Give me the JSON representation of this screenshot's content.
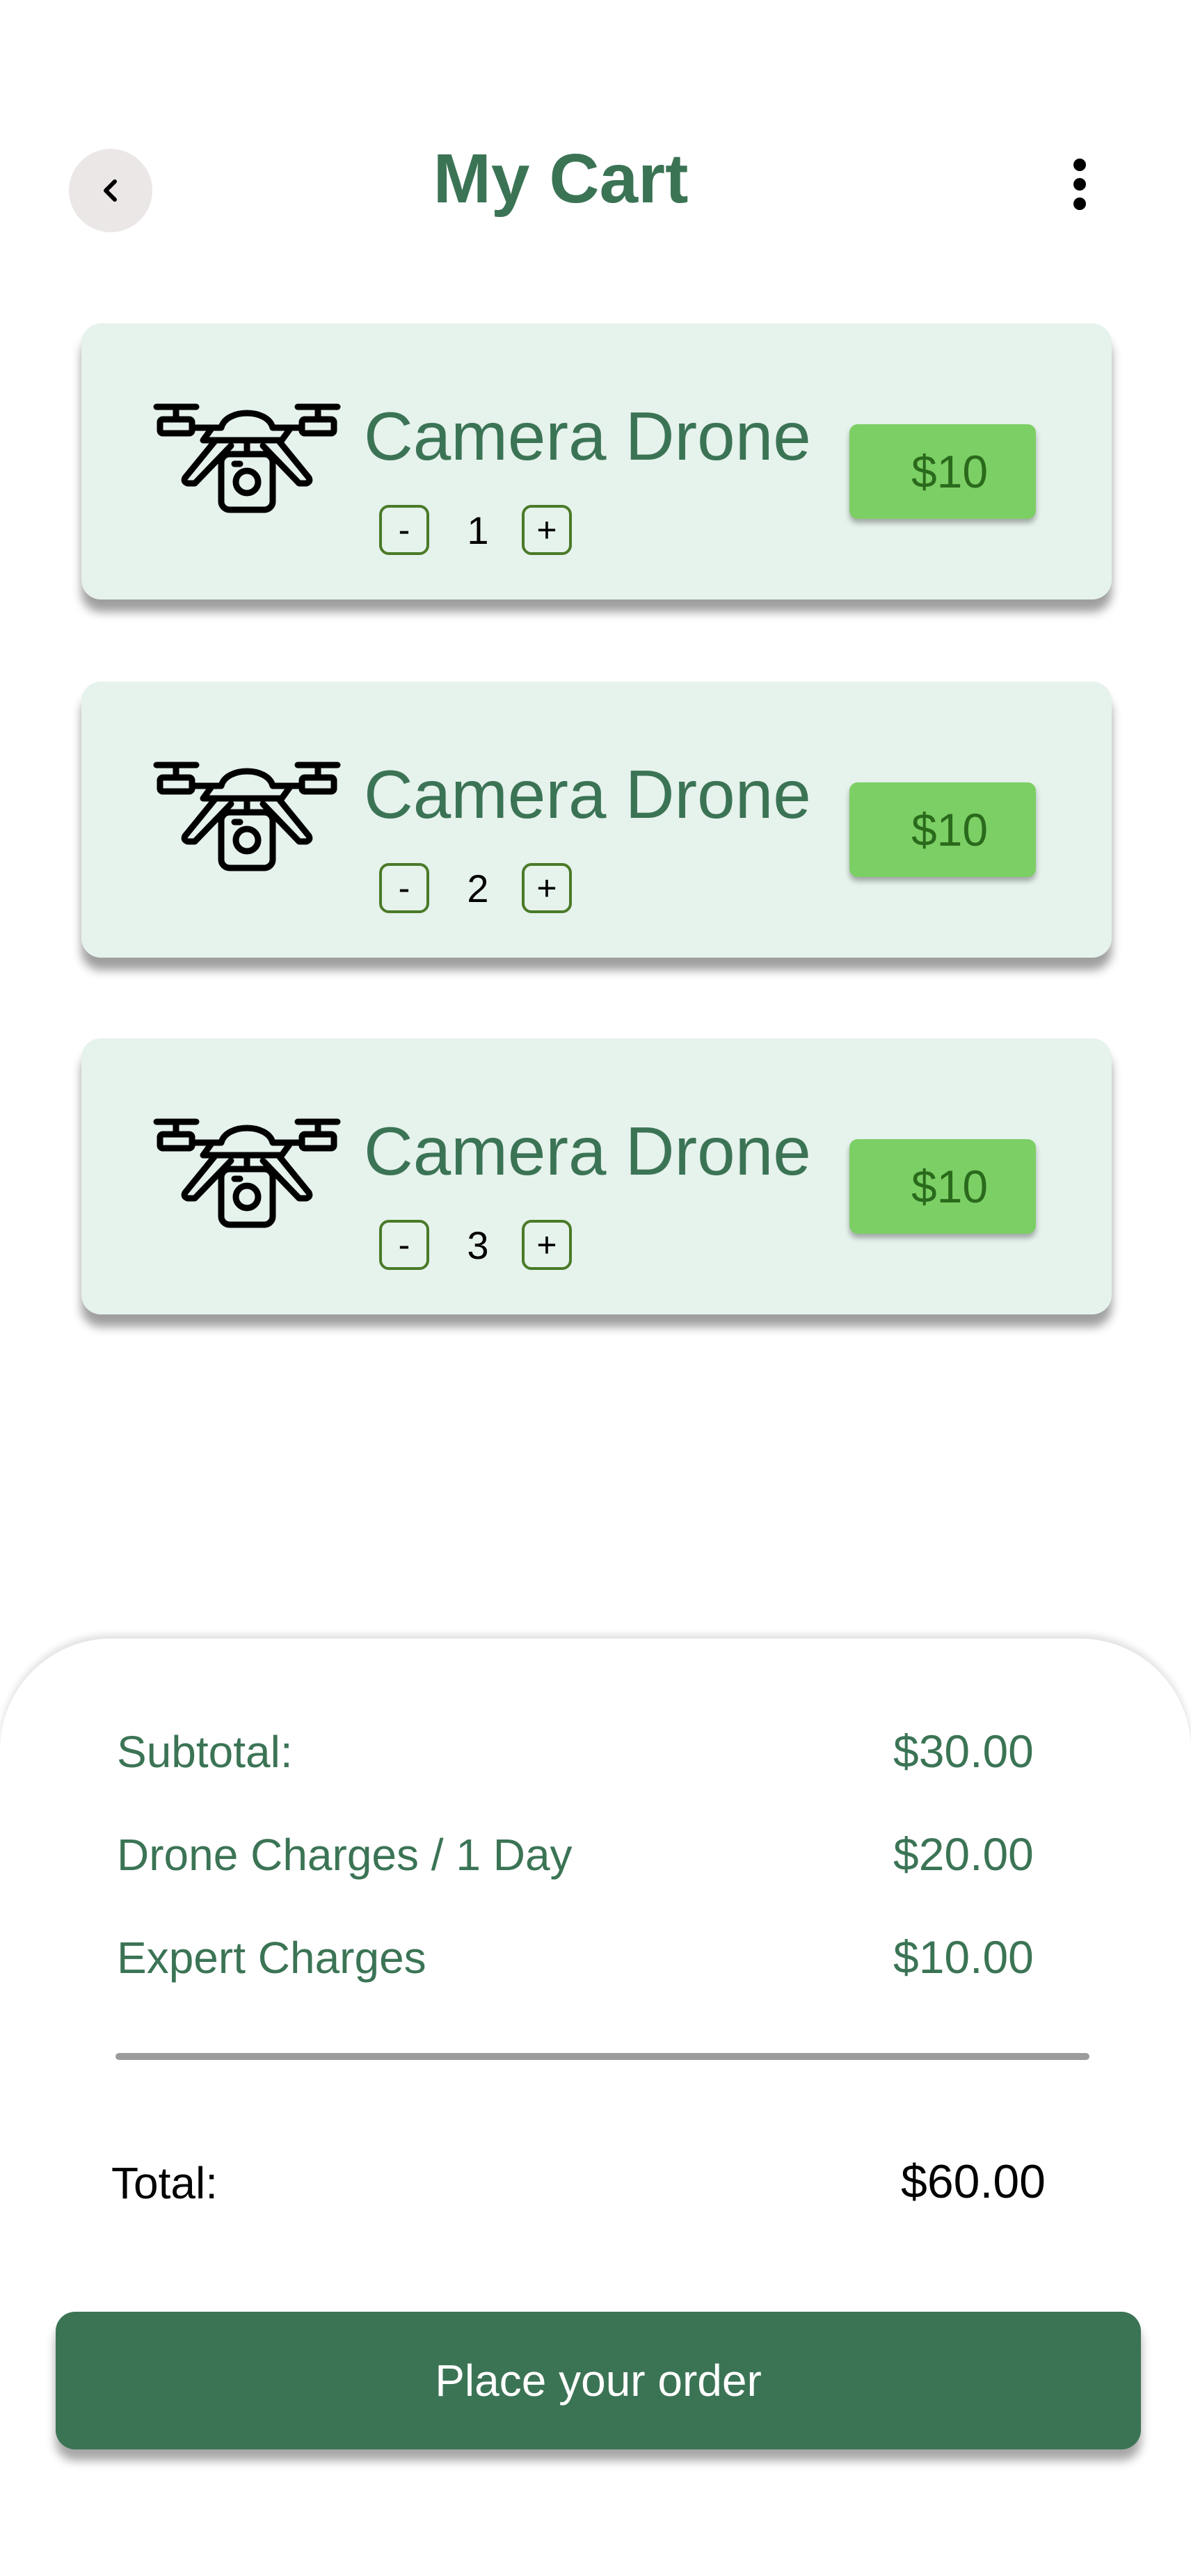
{
  "header": {
    "title": "My Cart",
    "back_icon": "chevron-left-icon",
    "menu_icon": "vertical-dots-icon"
  },
  "cart": {
    "items": [
      {
        "name": "Camera Drone",
        "quantity": "1",
        "price": "$10",
        "icon": "drone-icon"
      },
      {
        "name": "Camera Drone",
        "quantity": "2",
        "price": "$10",
        "icon": "drone-icon"
      },
      {
        "name": "Camera Drone",
        "quantity": "3",
        "price": "$10",
        "icon": "drone-icon"
      }
    ],
    "minus_label": "-",
    "plus_label": "+"
  },
  "summary": {
    "subtotal_label": "Subtotal:",
    "subtotal_value": "$30.00",
    "drone_charges_label": "Drone Charges / 1 Day",
    "drone_charges_value": "$20.00",
    "expert_charges_label": "Expert Charges",
    "expert_charges_value": "$10.00",
    "total_label": "Total:",
    "total_value": "$60.00"
  },
  "actions": {
    "place_order_label": "Place your order"
  },
  "colors": {
    "brand_green": "#3b7455",
    "card_background": "#e6f2ec",
    "price_tag": "#7ccf64",
    "divider": "#9c9c9c"
  }
}
